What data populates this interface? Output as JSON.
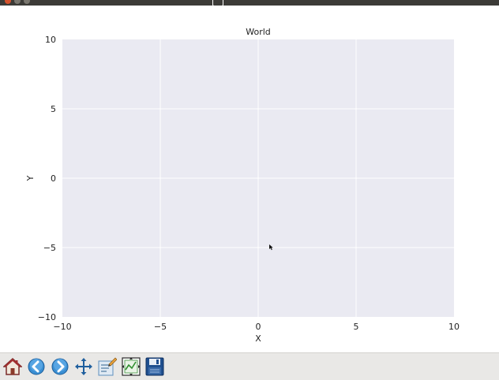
{
  "chart_data": {
    "type": "scatter",
    "title": "World",
    "xlabel": "X",
    "ylabel": "Y",
    "xlim": [
      -10,
      10
    ],
    "ylim": [
      -10,
      10
    ],
    "xticks": [
      -10,
      -5,
      0,
      5,
      10
    ],
    "yticks": [
      -10,
      -5,
      0,
      5,
      10
    ],
    "xtick_labels": [
      "−10",
      "−5",
      "0",
      "5",
      "10"
    ],
    "ytick_labels": [
      "−10",
      "−5",
      "0",
      "5",
      "10"
    ],
    "grid": true,
    "series": [],
    "colors": {
      "background": "#eaeaf2",
      "grid": "#ffffff"
    }
  },
  "toolbar": {
    "buttons": [
      {
        "icon": "home-icon"
      },
      {
        "icon": "back-arrow-icon"
      },
      {
        "icon": "forward-arrow-icon"
      },
      {
        "icon": "pan-icon"
      },
      {
        "icon": "zoom-rect-icon"
      },
      {
        "icon": "configure-subplots-icon"
      },
      {
        "icon": "save-icon"
      }
    ]
  }
}
